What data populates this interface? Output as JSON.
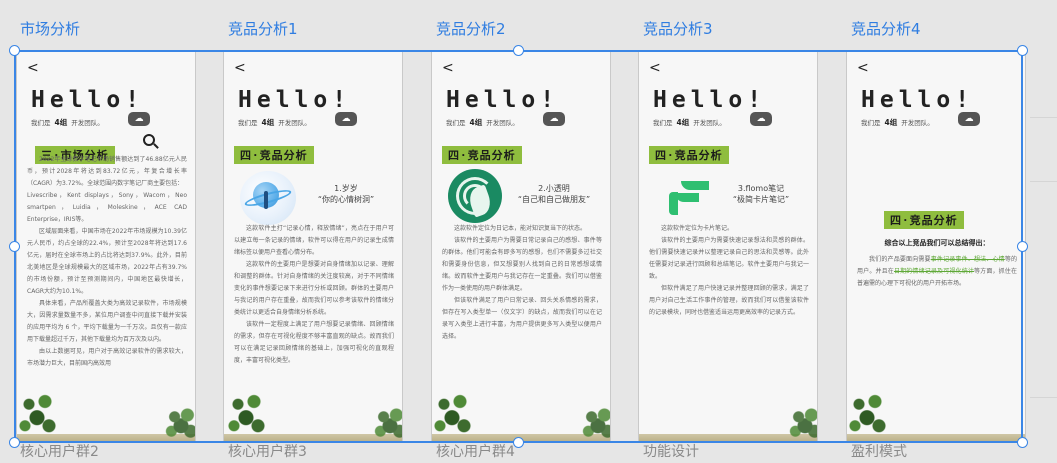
{
  "frames": [
    {
      "title": "市场分析",
      "bottom_label": "核心用户群2",
      "back": "<",
      "hello": "Hello!",
      "team_prefix": "我们是",
      "team_number": "4组",
      "team_suffix": "开发团队。",
      "section_label": "三·市场分析",
      "body": [
        "2022年全球数字笔记市场销售额达到了46.88亿元人民币，预计2028年将达到83.72亿元，年复合增长率（CAGR）为3.72%。全球范围内数字笔记厂商主要包括：",
        "Livescribe，Kent displays，Sony，Wacom，Neo smartpen，Luidia，Moleskine，ACE CAD Enterprise，IRIS等。",
        "区域层面来看，中国市场在2022年市场规模为10.39亿元人民币，约占全球的22.4%，预计至2028年将达到17.6亿元，届时在全球市场上的占比将达到37.9%。此外，目前北美地区是全球规模最大的区域市场，2022年占有39.7%的市场份额，预计至预测期间内，中国地区最快增长，CAGR大约为10.1%。",
        "具体来看，产品所覆盖大类为高效记录软件，市场规模大，因需求量数量不多，某位用户调查中问直接下载并安装的应用平均为 6 个，平均下载量为一千万次。且仅有一款应用下载量超过千万，其他下载量均为百万次及以内。",
        "由以上数据可见，用户对于高效记录软件的需求较大，市场潜力巨大，目前国内高效用"
      ]
    },
    {
      "title": "竞品分析1",
      "bottom_label": "核心用户群3",
      "back": "<",
      "hello": "Hello!",
      "team_prefix": "我们是",
      "team_number": "4组",
      "team_suffix": "开发团队。",
      "section_label": "四·竞品分析",
      "product_index": "1.岁岁",
      "product_slogan": "“你的心情树洞”",
      "body": [
        "这款软件主打“记录心情，释放情绪”，亮点在于用户可以建立每一条记录的情绪，软件可以得在用户的记录生成情绪标签以便用户查看心情分布。",
        "这款软件的主要用户是想要对自身情绪加以记录、理解和调整的群体。针对自身情绪的关注度较高，对于不同情绪变化的事件想要记录下来进行分析或回顾。群体的主要用户与我记的用户存在重叠，故而我们可以参考该软件的情绪分类统计以更适合自身情绪分析系统。",
        "该软件一定程度上满足了用户想要记录情绪、回顾情绪的需求，但存在可视化程度不够丰富直观的缺点。故而我们可以在满足记录回顾情绪的基础上，加强可视化的直观程度，丰富可视化类型。"
      ]
    },
    {
      "title": "竞品分析2",
      "bottom_label": "核心用户群4",
      "back": "<",
      "hello": "Hello!",
      "team_prefix": "我们是",
      "team_number": "4组",
      "team_suffix": "开发团队。",
      "section_label": "四·竞品分析",
      "product_index": "2.小透明",
      "product_slogan": "“自己和自己做朋友”",
      "body": [
        "这款软件定位为日记本，能对知识复当下的状态。",
        "该软件的主要用户为需要日常记录自己的感想、事件等的群体。他们可能会有即多写的感想，也们不需要多过社交和需要身份信息，但又想要别人找到自己的日常感想或情绪。故而软件主要用户与我记存在一定重叠。我们可以借鉴作为一类使用的用户群体满足。",
        "但该软件满足了用户日常记录、回头关系情感的需求，但存在写入类型单一（仅文字）的缺点，故而我们可以在记录写入类型上进行丰富，为用户提供更多写入类型以便用户选择。"
      ]
    },
    {
      "title": "竞品分析3",
      "bottom_label": "功能设计",
      "back": "<",
      "hello": "Hello!",
      "team_prefix": "我们是",
      "team_number": "4组",
      "team_suffix": "开发团队。",
      "section_label": "四·竞品分析",
      "product_index": "3.flomo笔记",
      "product_slogan": "“极简卡片笔记”",
      "body": [
        "这款软件定位为卡片笔记。",
        "该软件的主要用户为需要快速记录想法和灵感的群体。他们需要快速记录并以整理记录自己的思法和灵感等。此外任需要对记录进行回顾和总结笔记。软件主要用户与我记一致。",
        "但软件满足了用户快速记录并整理回顾的需求，满足了用户对自己生活工作事件的管理，故而我们可以借鉴该软件的记录模块，同时也借鉴适当运用更高效率的记录方式。"
      ]
    },
    {
      "title": "竞品分析4",
      "bottom_label": "盈利模式",
      "back": "<",
      "hello": "Hello!",
      "team_prefix": "我们是",
      "team_number": "4组",
      "team_suffix": "开发团队。",
      "section_label": "四·竞品分析",
      "summary_title": "综合以上竞品我们可以总结得出：",
      "summary_plain_1": "我们的产品要面向需要",
      "summary_strike_1": "事件记录事件、想法、心情",
      "summary_plain_2": "等的用户。并且在",
      "summary_strike_2": "日期的情绪记录及可视化统计",
      "summary_plain_3": "等方面，抓住在普遍需的心理下可视化的用户开拓市场。"
    }
  ]
}
